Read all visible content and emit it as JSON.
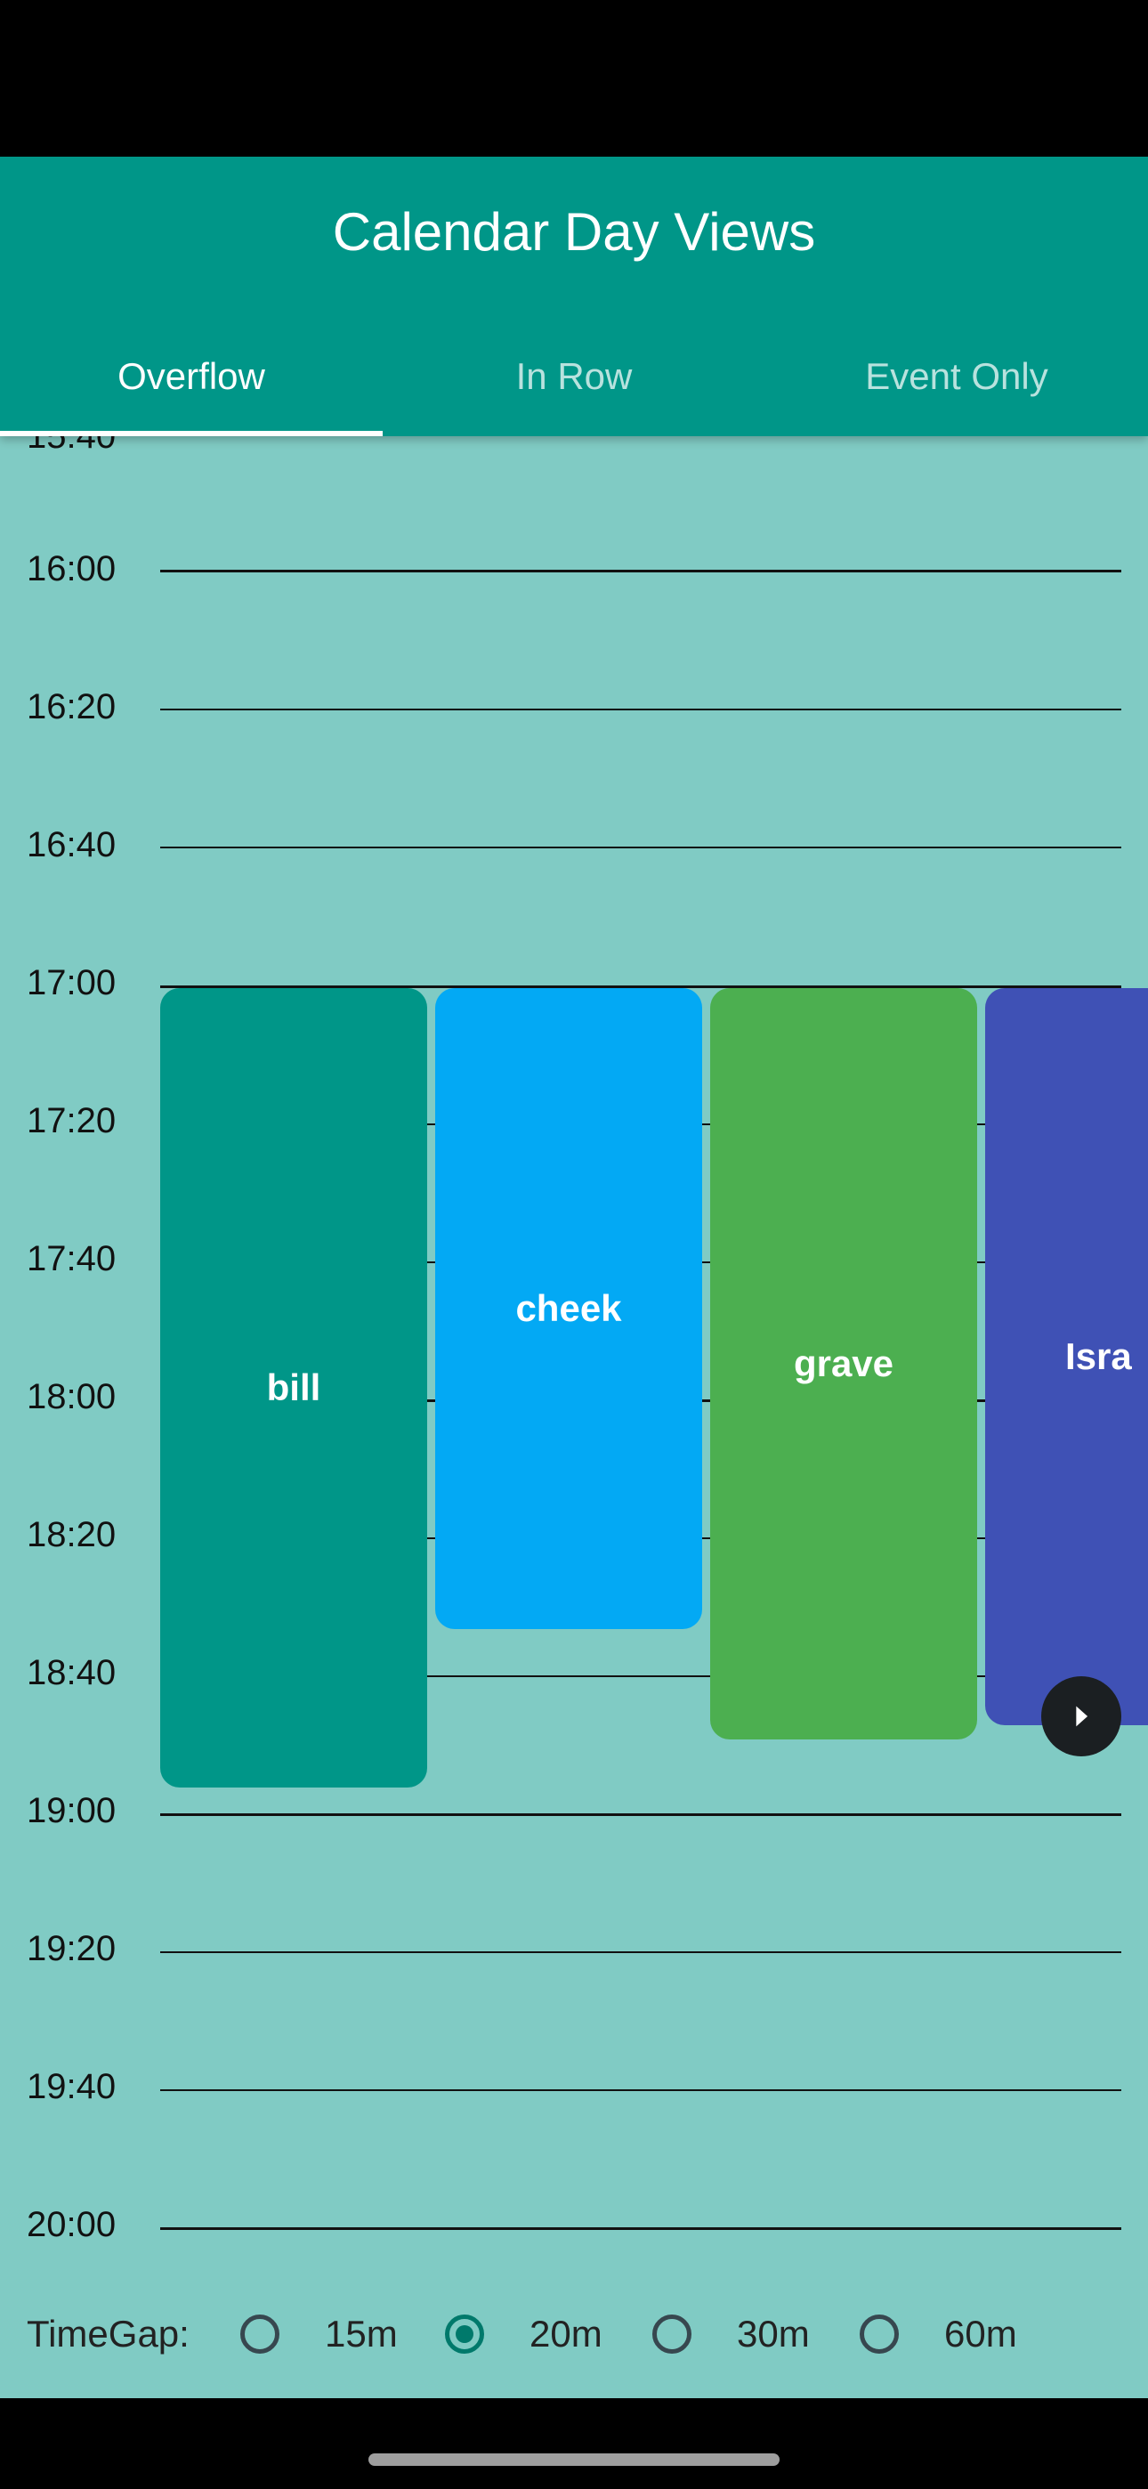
{
  "app": {
    "title": "Calendar Day Views"
  },
  "tabs": [
    {
      "label": "Overflow",
      "selected": true
    },
    {
      "label": "In Row",
      "selected": false
    },
    {
      "label": "Event Only",
      "selected": false
    }
  ],
  "timeline": {
    "partial_top_label": "15:40",
    "times": [
      "16:00",
      "16:20",
      "16:40",
      "17:00",
      "17:20",
      "17:40",
      "18:00",
      "18:20",
      "18:40",
      "19:00",
      "19:20",
      "19:40",
      "20:00"
    ]
  },
  "events": [
    {
      "title": "bill",
      "color": "#009688"
    },
    {
      "title": "cheek",
      "color": "#03A9F4"
    },
    {
      "title": "grave",
      "color": "#4CAF50"
    },
    {
      "title": "Isra",
      "color": "#3F51B5"
    }
  ],
  "scroll_button": {
    "icon": "chevron-right-icon"
  },
  "timegap": {
    "label": "TimeGap:",
    "options": [
      {
        "label": "15m",
        "selected": false
      },
      {
        "label": "20m",
        "selected": true
      },
      {
        "label": "30m",
        "selected": false
      },
      {
        "label": "60m",
        "selected": false
      }
    ]
  }
}
